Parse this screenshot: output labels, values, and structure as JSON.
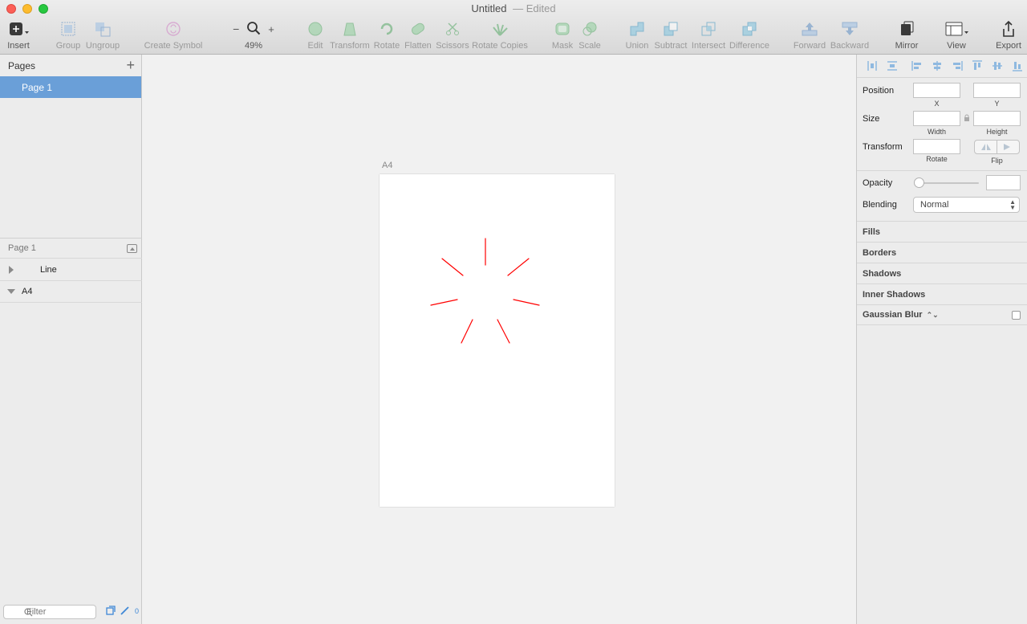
{
  "window": {
    "title": "Untitled",
    "status": "— Edited"
  },
  "toolbar": {
    "insert": "Insert",
    "group": "Group",
    "ungroup": "Ungroup",
    "create_symbol": "Create Symbol",
    "zoom": "49%",
    "edit": "Edit",
    "transform": "Transform",
    "rotate": "Rotate",
    "flatten": "Flatten",
    "scissors": "Scissors",
    "rotate_copies": "Rotate Copies",
    "mask": "Mask",
    "scale": "Scale",
    "union": "Union",
    "subtract": "Subtract",
    "intersect": "Intersect",
    "difference": "Difference",
    "forward": "Forward",
    "backward": "Backward",
    "mirror": "Mirror",
    "view": "View",
    "export": "Export"
  },
  "sidebar": {
    "pages_title": "Pages",
    "pages": [
      {
        "label": "Page 1"
      }
    ],
    "layers_title": "Page 1",
    "layers": [
      {
        "label": "Line"
      },
      {
        "label": "A4"
      }
    ],
    "filter_placeholder": "Filter",
    "slice_count": "0"
  },
  "canvas": {
    "artboard_label": "A4",
    "accent_color": "#ff0000"
  },
  "inspector": {
    "position_label": "Position",
    "x_label": "X",
    "y_label": "Y",
    "size_label": "Size",
    "width_label": "Width",
    "height_label": "Height",
    "transform_label": "Transform",
    "rotate_label": "Rotate",
    "flip_label": "Flip",
    "opacity_label": "Opacity",
    "blending_label": "Blending",
    "blending_value": "Normal",
    "sections": [
      "Fills",
      "Borders",
      "Shadows",
      "Inner Shadows",
      "Gaussian Blur"
    ]
  }
}
